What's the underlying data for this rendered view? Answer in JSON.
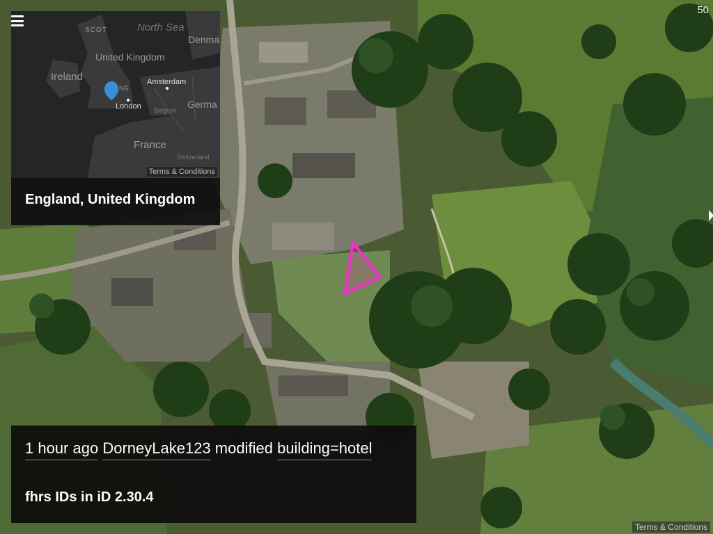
{
  "counter": "50",
  "overview": {
    "labels": {
      "scotland": "SCOT",
      "north_sea": "North Sea",
      "denmark": "Denma",
      "uk": "United Kingdom",
      "ireland": "Ireland",
      "england_abbrev": "NG.",
      "amsterdam": "Amsterdam",
      "london": "London",
      "belgium": "Belgium",
      "germany": "Germa",
      "france": "France",
      "switzerland": "Switzerland"
    },
    "terms": "Terms & Conditions",
    "place": "England, United Kingdom"
  },
  "feed": {
    "time": "1 hour ago",
    "user": "DorneyLake123",
    "action": "modified",
    "tag": "building=hotel",
    "comment": "fhrs IDs in iD 2.30.4"
  },
  "map": {
    "terms": "Terms & Conditions",
    "highlight_color": "#ff2ad4"
  }
}
